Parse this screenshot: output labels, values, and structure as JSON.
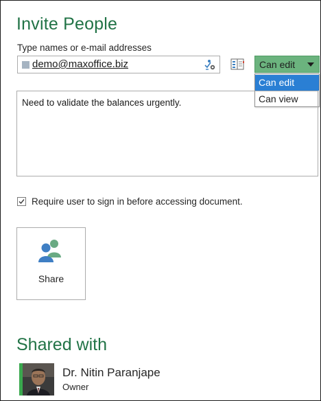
{
  "invite": {
    "title": "Invite People",
    "names_label": "Type names or e-mail addresses",
    "recipient": "demo@maxoffice.biz"
  },
  "permission": {
    "selected": "Can edit",
    "options": [
      "Can edit",
      "Can view"
    ]
  },
  "message": {
    "text": "Need to validate the balances urgently."
  },
  "require_signin": {
    "checked": true,
    "label": "Require user to sign in before accessing document."
  },
  "share_button": {
    "label": "Share"
  },
  "shared_with": {
    "title": "Shared with",
    "people": [
      {
        "name": "Dr. Nitin Paranjape",
        "role": "Owner"
      }
    ]
  },
  "colors": {
    "accent": "#217346",
    "dropdown_bg": "#6bb37e",
    "selection": "#2a7fd4",
    "presence": "#3aa84e"
  },
  "icons": [
    "check-names-icon",
    "address-book-icon",
    "chevron-down-icon",
    "checkbox-check-icon",
    "people-share-icon"
  ]
}
